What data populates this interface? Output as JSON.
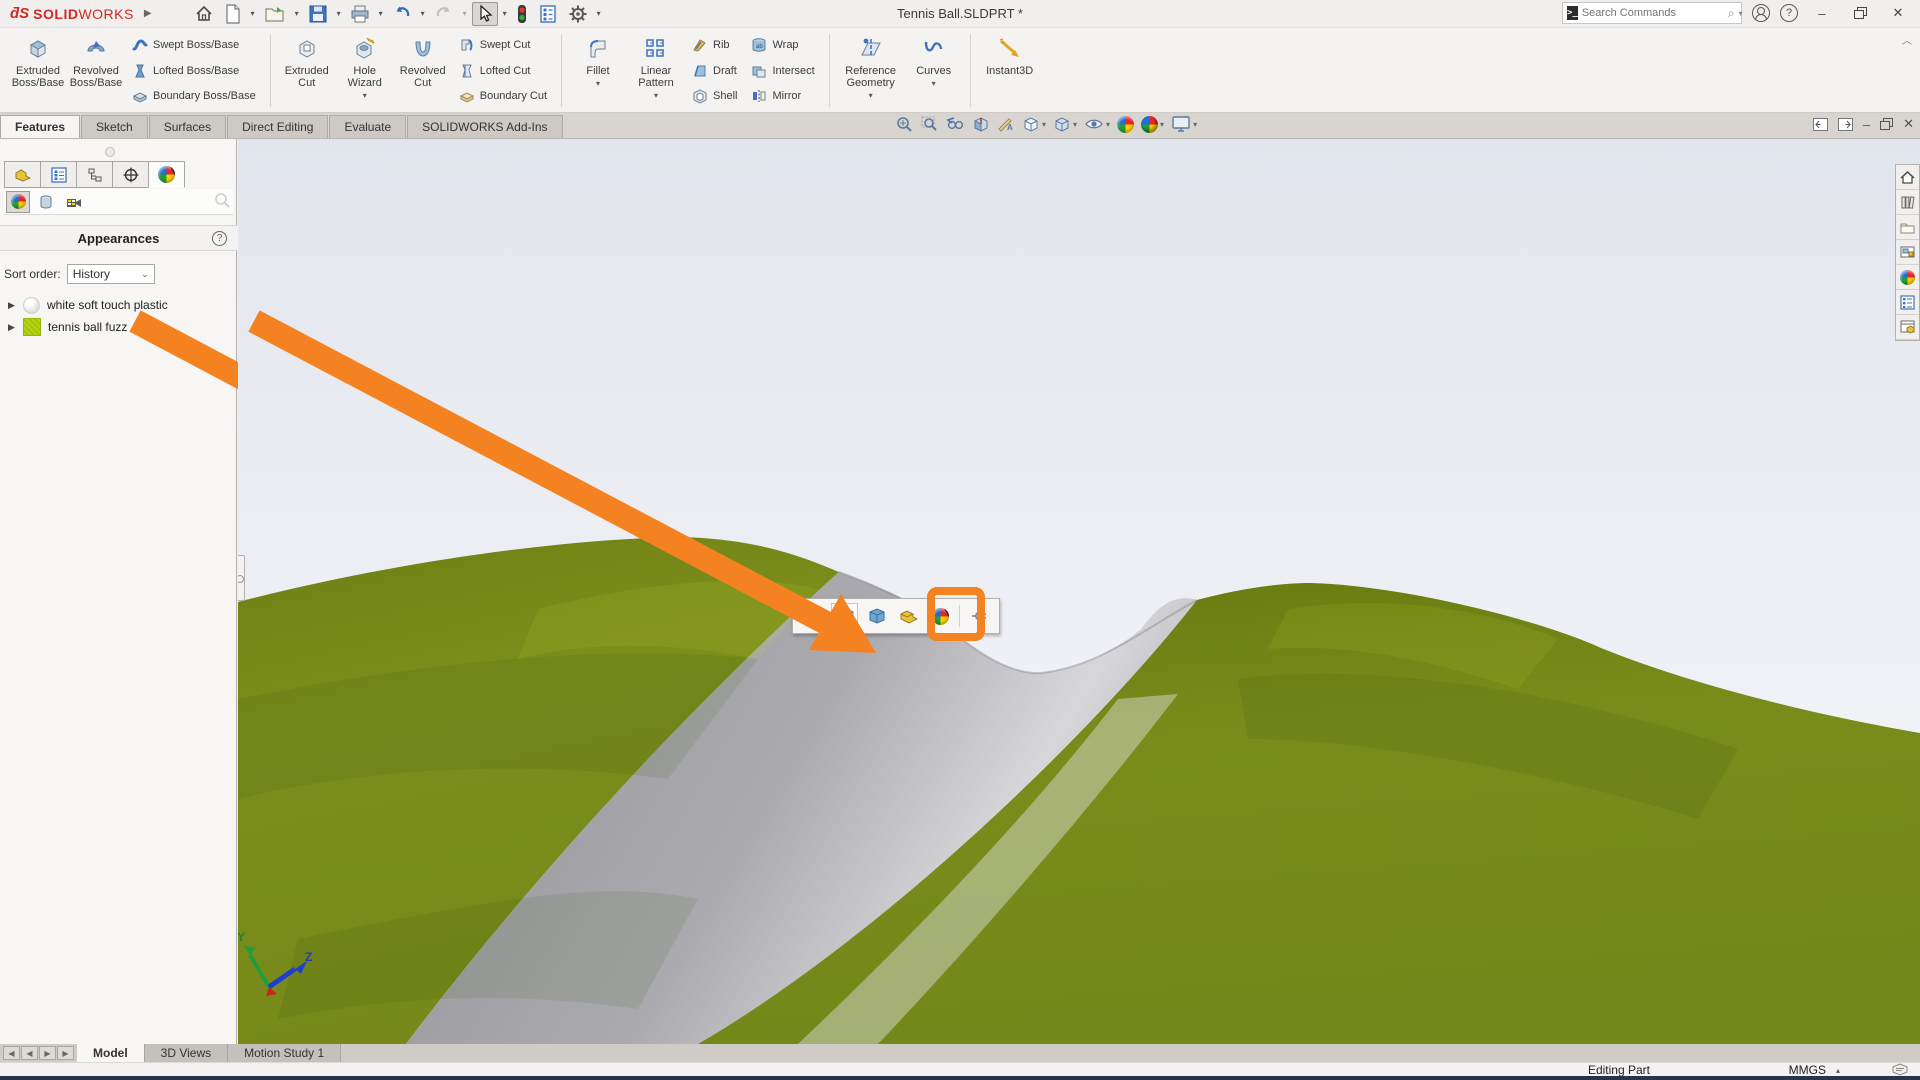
{
  "titlebar": {
    "brand_prefix": "SOLID",
    "brand_suffix": "WORKS",
    "title": "Tennis Ball.SLDPRT *",
    "search_placeholder": "Search Commands"
  },
  "tabs": {
    "items": [
      "Features",
      "Sketch",
      "Surfaces",
      "Direct Editing",
      "Evaluate",
      "SOLIDWORKS Add-Ins"
    ],
    "active": "Features"
  },
  "ribbon": {
    "boss": {
      "extruded": "Extruded Boss/Base",
      "revolved": "Revolved Boss/Base",
      "swept": "Swept Boss/Base",
      "lofted": "Lofted Boss/Base",
      "boundary": "Boundary Boss/Base"
    },
    "cut": {
      "extruded": "Extruded Cut",
      "hole_wizard": "Hole Wizard",
      "revolved": "Revolved Cut",
      "swept": "Swept Cut",
      "lofted": "Lofted Cut",
      "boundary": "Boundary Cut"
    },
    "features": {
      "fillet": "Fillet",
      "linear_pattern": "Linear Pattern",
      "rib": "Rib",
      "draft": "Draft",
      "shell": "Shell",
      "wrap": "Wrap",
      "intersect": "Intersect",
      "mirror": "Mirror"
    },
    "reference": {
      "reference_geometry": "Reference Geometry",
      "curves": "Curves"
    },
    "instant3d": "Instant3D"
  },
  "left_panel": {
    "header": "Appearances",
    "sort_label": "Sort order:",
    "sort_value": "History",
    "items": [
      {
        "label": "white soft touch plastic"
      },
      {
        "label": "tennis ball fuzz"
      }
    ]
  },
  "viewport": {
    "triad": {
      "y_label": "Y",
      "z_label": "Z"
    }
  },
  "bottom_tabs": {
    "items": [
      "Model",
      "3D Views",
      "Motion Study 1"
    ],
    "active": "Model"
  },
  "status_bar": {
    "mode": "Editing Part",
    "units": "MMGS"
  },
  "icons": {
    "logo_mark": "ƌS",
    "home": "⌂",
    "help": "?",
    "minimize": "–",
    "close": "✕",
    "dropdown": "▾",
    "expander": "▶",
    "collapse_ribbon": "︿",
    "nav_first": "◀",
    "nav_prev": "◀",
    "nav_next": "▶",
    "nav_last": "▶",
    "units_up": "▴",
    "search": "⌕"
  },
  "colors": {
    "accent_orange": "#f58220",
    "fuzz_green": "#7b8e1c",
    "seam_gray": "#ababae",
    "sky_top": "#e2e5ed",
    "sky_bottom": "#fafbfc",
    "brand_red": "#d02a22"
  }
}
